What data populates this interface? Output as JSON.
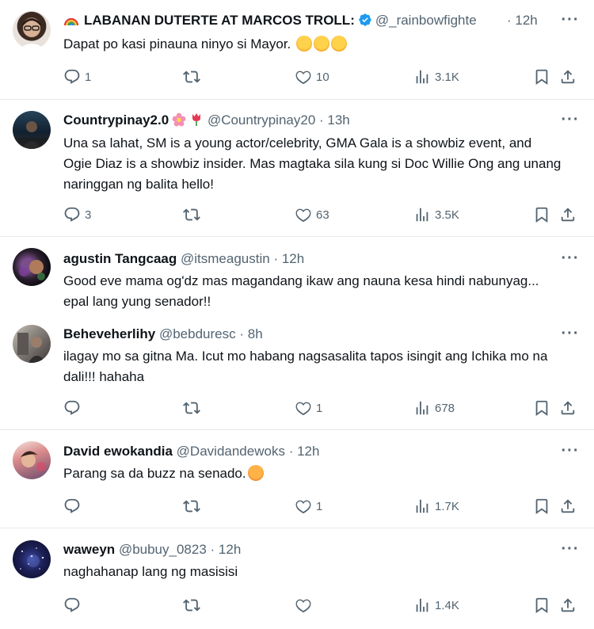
{
  "tweets": [
    {
      "name": "LABANAN DUTERTE AT MARCOS TROLL:",
      "handle": "@_rainbowfighte",
      "time": "· 12h",
      "text": "Dapat po kasi pinauna ninyo si Mayor.",
      "replies": "1",
      "reposts": "",
      "likes": "10",
      "views": "3.1K"
    },
    {
      "name": "Countrypinay2.0",
      "handle": "@Countrypinay20",
      "time": "· 13h",
      "text": "Una sa lahat, SM is a young actor/celebrity, GMA Gala is a showbiz event, and Ogie Diaz is a showbiz insider. Mas magtaka sila kung si Doc Willie Ong ang unang naringgan ng balita hello!",
      "replies": "3",
      "reposts": "",
      "likes": "63",
      "views": "3.5K"
    },
    {
      "name": "agustin Tangcaag",
      "handle": "@itsmeagustin",
      "time": "· 12h",
      "text": "Good eve mama og'dz mas magandang ikaw ang nauna kesa hindi nabunyag... epal lang yung senador!!"
    },
    {
      "name": "Beheveherlihy",
      "handle": "@bebduresc",
      "time": "· 8h",
      "text": "ilagay mo sa gitna Ma. Icut mo habang nagsasalita tapos isingit ang Ichika mo na dali!!! hahaha",
      "replies": "",
      "reposts": "",
      "likes": "1",
      "views": "678"
    },
    {
      "name": "David ewokandia",
      "handle": "@Davidandewoks",
      "time": "· 12h",
      "text": "Parang sa da buzz na senado.",
      "replies": "",
      "reposts": "",
      "likes": "1",
      "views": "1.7K"
    },
    {
      "name": "waweyn",
      "handle": "@bubuy_0823",
      "time": "· 12h",
      "text": "naghahanap lang ng masisisi",
      "replies": "",
      "reposts": "",
      "likes": "",
      "views": "1.4K"
    }
  ],
  "icons": {
    "more": "more-icon",
    "reply": "reply-icon",
    "repost": "repost-icon",
    "like": "heart-icon",
    "views": "views-icon",
    "bookmark": "bookmark-icon",
    "share": "share-icon",
    "verified": "verified-badge-icon"
  },
  "colors": {
    "text": "#0f1419",
    "secondary": "#536471",
    "divider": "#e6e9eb",
    "verified": "#1d9bf0"
  }
}
